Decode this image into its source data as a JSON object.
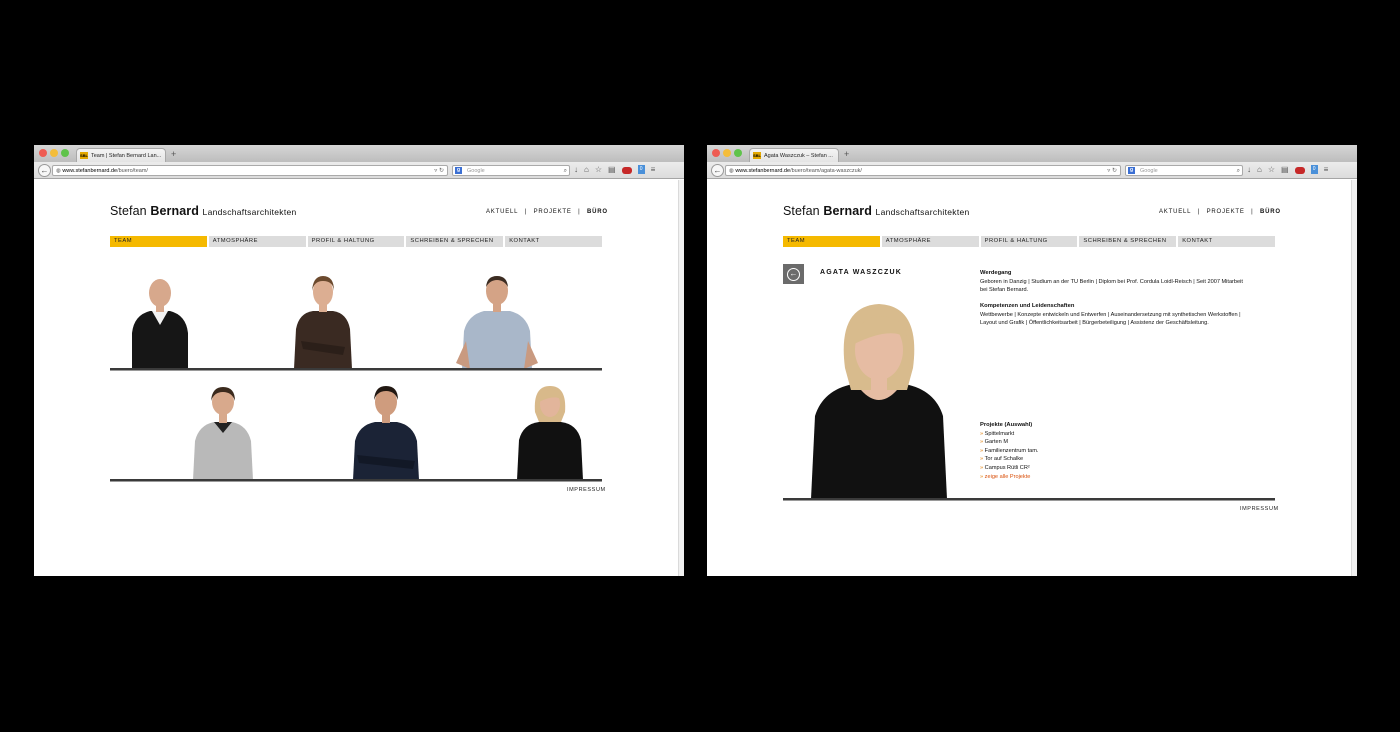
{
  "window_left": {
    "tab_title": "Team | Stefan Bernard Lan...",
    "url_domain": "www.stefanbernard.de",
    "url_path": "/buero/team/",
    "search_placeholder": "Google",
    "logo": {
      "first": "Stefan",
      "last": "Bernard",
      "suffix": "Landschaftsarchitekten"
    },
    "topnav": [
      "AKTUELL",
      "|",
      "PROJEKTE",
      "|",
      "BÜRO"
    ],
    "tabs": [
      "TEAM",
      "ATMOSPHÄRE",
      "PROFIL & HALTUNG",
      "SCHREIBEN & SPRECHEN",
      "KONTAKT"
    ],
    "impressum": "IMPRESSUM"
  },
  "window_right": {
    "tab_title": "Agata Waszczuk – Stefan ...",
    "url_domain": "www.stefanbernard.de",
    "url_path": "/buero/team/agata-waszczuk/",
    "search_placeholder": "Google",
    "logo": {
      "first": "Stefan",
      "last": "Bernard",
      "suffix": "Landschaftsarchitekten"
    },
    "topnav": [
      "AKTUELL",
      "|",
      "PROJEKTE",
      "|",
      "BÜRO"
    ],
    "tabs": [
      "TEAM",
      "ATMOSPHÄRE",
      "PROFIL & HALTUNG",
      "SCHREIBEN & SPRECHEN",
      "KONTAKT"
    ],
    "person_name": "AGATA WASZCZUK",
    "werdegang_title": "Werdegang",
    "werdegang_text": "Geboren in Danzig | Studium an der TU Berlin | Diplom bei Prof. Cordula Loidl-Reisch | Seit 2007 Mitarbeit bei Stefan Bernard.",
    "kompetenzen_title": "Kompetenzen und Leidenschaften",
    "kompetenzen_text": "Wettbewerbe | Konzepte entwickeln und Entwerfen | Auseinandersetzung mit synthetischen Werkstoffen | Layout und Grafik | Öffentlichkeitsarbeit | Bürgerbeteiligung | Assistenz der Geschäftsleitung.",
    "projekte_title": "Projekte (Auswahl)",
    "projekte": [
      "Spittelmarkt",
      "Garten M",
      "Familienzentrum tam.",
      "Tor auf Schalke",
      "Campus Rütli CR²"
    ],
    "projekte_all": "zeige alle Projekte",
    "impressum": "IMPRESSUM"
  },
  "colors": {
    "accent": "#f5b900",
    "tab_bg": "#dcdcdc",
    "link": "#d9500b"
  }
}
